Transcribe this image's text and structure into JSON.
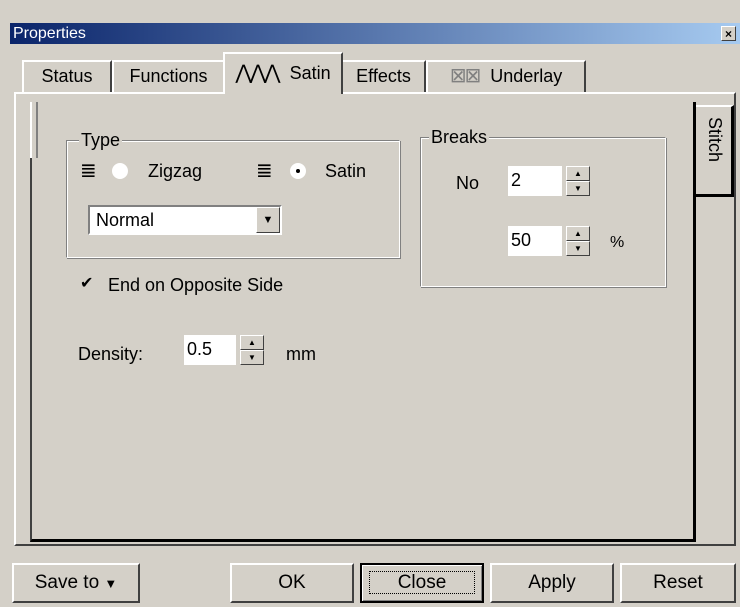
{
  "window": {
    "title": "Properties",
    "close_glyph": "×"
  },
  "tabs": [
    {
      "label": "Status",
      "icon": "",
      "active": false
    },
    {
      "label": "Functions",
      "icon": "",
      "active": false
    },
    {
      "label": "Satin",
      "icon": "satin-stitch-icon",
      "active": true
    },
    {
      "label": "Effects",
      "icon": "",
      "active": false
    },
    {
      "label": "Underlay",
      "icon": "underlay-icon",
      "active": false
    }
  ],
  "side_tab": {
    "label": "Stitch"
  },
  "type_group": {
    "title": "Type",
    "zigzag_label": "Zigzag",
    "satin_label": "Satin",
    "selected": "Satin",
    "style_value": "Normal"
  },
  "breaks_group": {
    "title": "Breaks",
    "no_label": "No",
    "no_value": "2",
    "percent_value": "50",
    "percent_unit": "%"
  },
  "end_opposite": {
    "label": "End on Opposite Side",
    "checked": true
  },
  "density": {
    "label": "Density:",
    "value": "0.5",
    "unit": "mm"
  },
  "buttons": {
    "save_to": "Save to",
    "ok": "OK",
    "close": "Close",
    "apply": "Apply",
    "reset": "Reset"
  }
}
